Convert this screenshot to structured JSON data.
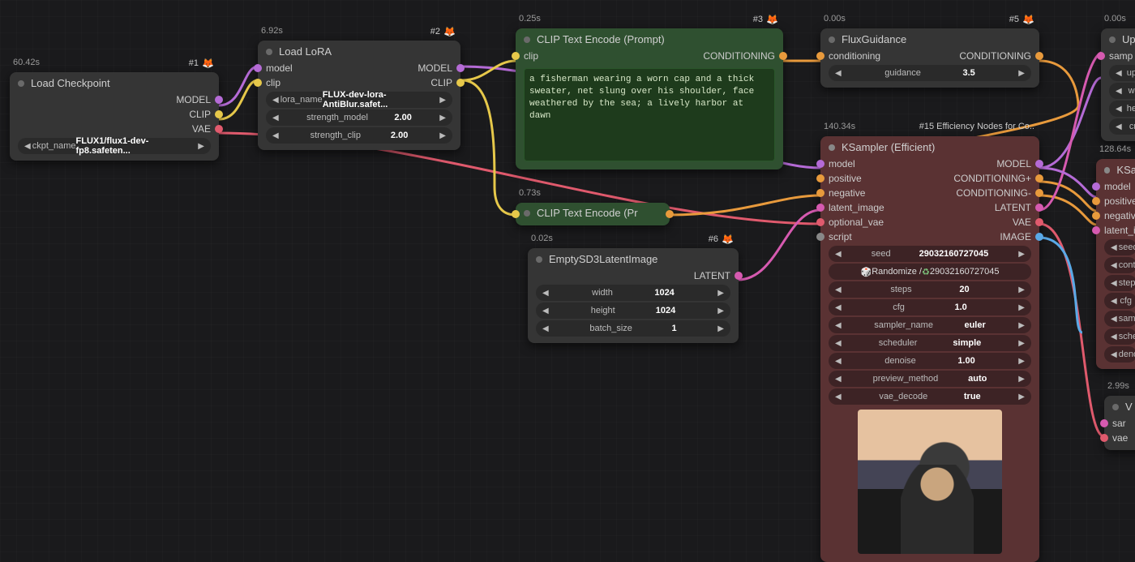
{
  "nodes": {
    "load_checkpoint": {
      "timing": "60.42s",
      "badge": "#1",
      "title": "Load Checkpoint",
      "outputs": {
        "model": "MODEL",
        "clip": "CLIP",
        "vae": "VAE"
      },
      "ckpt_label": "ckpt_name",
      "ckpt_value": "FLUX1/flux1-dev-fp8.safeten..."
    },
    "load_lora": {
      "timing": "6.92s",
      "badge": "#2",
      "title": "Load LoRA",
      "inputs": {
        "model": "model",
        "clip": "clip"
      },
      "outputs": {
        "model": "MODEL",
        "clip": "CLIP"
      },
      "lora_name_label": "lora_name",
      "lora_name_value": "FLUX-dev-lora-AntiBlur.safet...",
      "strength_model_label": "strength_model",
      "strength_model_value": "2.00",
      "strength_clip_label": "strength_clip",
      "strength_clip_value": "2.00"
    },
    "clip_encode_pos": {
      "timing": "0.25s",
      "badge": "#3",
      "title": "CLIP Text Encode (Prompt)",
      "inputs": {
        "clip": "clip"
      },
      "outputs": {
        "conditioning": "CONDITIONING"
      },
      "prompt": "a fisherman wearing a worn cap and a thick sweater, net slung over his shoulder, face weathered by the sea; a lively harbor at dawn"
    },
    "clip_encode_neg": {
      "timing": "0.73s",
      "title": "CLIP Text Encode (Pr"
    },
    "flux_guidance": {
      "timing": "0.00s",
      "badge": "#5",
      "title": "FluxGuidance",
      "inputs": {
        "conditioning": "conditioning"
      },
      "outputs": {
        "conditioning": "CONDITIONING"
      },
      "guidance_label": "guidance",
      "guidance_value": "3.5"
    },
    "empty_latent": {
      "timing": "0.02s",
      "badge": "#6",
      "title": "EmptySD3LatentImage",
      "outputs": {
        "latent": "LATENT"
      },
      "width_label": "width",
      "width_value": "1024",
      "height_label": "height",
      "height_value": "1024",
      "batch_label": "batch_size",
      "batch_value": "1"
    },
    "ksampler": {
      "timing": "140.34s",
      "badge": "#15 Efficiency Nodes for Co..",
      "title": "KSampler (Efficient)",
      "inputs": {
        "model": "model",
        "positive": "positive",
        "negative": "negative",
        "latent_image": "latent_image",
        "optional_vae": "optional_vae",
        "script": "script"
      },
      "outputs": {
        "model": "MODEL",
        "cond_plus": "CONDITIONING+",
        "cond_minus": "CONDITIONING-",
        "latent": "LATENT",
        "vae": "VAE",
        "image": "IMAGE"
      },
      "seed_label": "seed",
      "seed_value": "29032160727045",
      "randomize_label": "Randomize /",
      "randomize_value": "29032160727045",
      "steps_label": "steps",
      "steps_value": "20",
      "cfg_label": "cfg",
      "cfg_value": "1.0",
      "sampler_label": "sampler_name",
      "sampler_value": "euler",
      "scheduler_label": "scheduler",
      "scheduler_value": "simple",
      "denoise_label": "denoise",
      "denoise_value": "1.00",
      "preview_label": "preview_method",
      "preview_value": "auto",
      "vae_decode_label": "vae_decode",
      "vae_decode_value": "true"
    },
    "upscale": {
      "timing": "0.00s",
      "title": "Up",
      "inputs": {
        "samples": "samp",
        "upscale": "up",
        "width": "wi",
        "height": "he",
        "crop": "cr"
      }
    },
    "ksampler2": {
      "timing": "128.64s",
      "title": "KSa",
      "inputs": {
        "model": "model",
        "positive": "positive",
        "negative": "negative",
        "latent_image": "latent_i"
      },
      "widgets": [
        "seed",
        "cont",
        "steps",
        "cfg",
        "samp",
        "sche",
        "deno"
      ]
    },
    "vae_decode": {
      "timing": "2.99s",
      "title": "V",
      "inputs": {
        "samples": "sar",
        "vae": "vae"
      }
    }
  }
}
